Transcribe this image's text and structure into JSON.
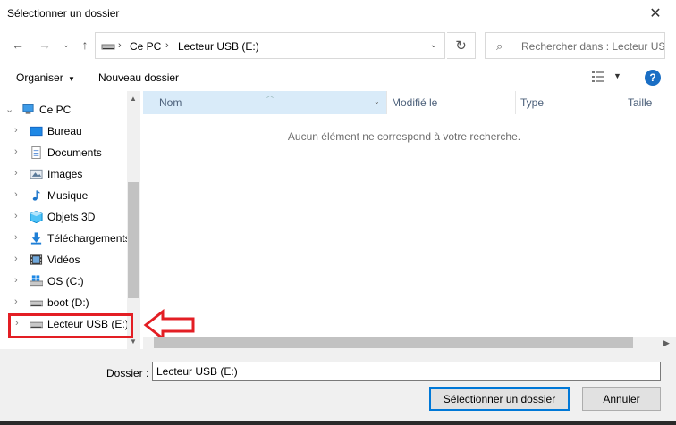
{
  "window": {
    "title": "Sélectionner un dossier",
    "close_icon": "close-icon"
  },
  "nav": {
    "address_crumbs": [
      "Ce PC",
      "Lecteur USB (E:)"
    ],
    "search_placeholder": "Rechercher dans : Lecteur US..."
  },
  "toolbar": {
    "organiser": "Organiser",
    "new_folder": "Nouveau dossier",
    "help": "?"
  },
  "tree": {
    "items": [
      {
        "label": "Ce PC",
        "icon": "pc-icon"
      },
      {
        "label": "Bureau",
        "icon": "desktop-icon"
      },
      {
        "label": "Documents",
        "icon": "documents-icon"
      },
      {
        "label": "Images",
        "icon": "images-icon"
      },
      {
        "label": "Musique",
        "icon": "music-icon"
      },
      {
        "label": "Objets 3D",
        "icon": "objects3d-icon"
      },
      {
        "label": "Téléchargements",
        "icon": "downloads-icon"
      },
      {
        "label": "Vidéos",
        "icon": "videos-icon"
      },
      {
        "label": "OS (C:)",
        "icon": "windows-drive-icon"
      },
      {
        "label": "boot (D:)",
        "icon": "drive-icon"
      },
      {
        "label": "Lecteur USB (E:)",
        "icon": "usb-drive-icon"
      }
    ],
    "partial_next": "boot (D:)"
  },
  "columns": {
    "name": "Nom",
    "modified": "Modifié le",
    "type": "Type",
    "size": "Taille"
  },
  "empty_message": "Aucun élément ne correspond à votre recherche.",
  "footer": {
    "folder_label": "Dossier :",
    "folder_value": "Lecteur USB (E:)",
    "select_button": "Sélectionner un dossier",
    "cancel_button": "Annuler"
  },
  "colors": {
    "accent": "#0078d7",
    "highlight": "#e31e24",
    "header_selected": "#d9ebf9"
  }
}
